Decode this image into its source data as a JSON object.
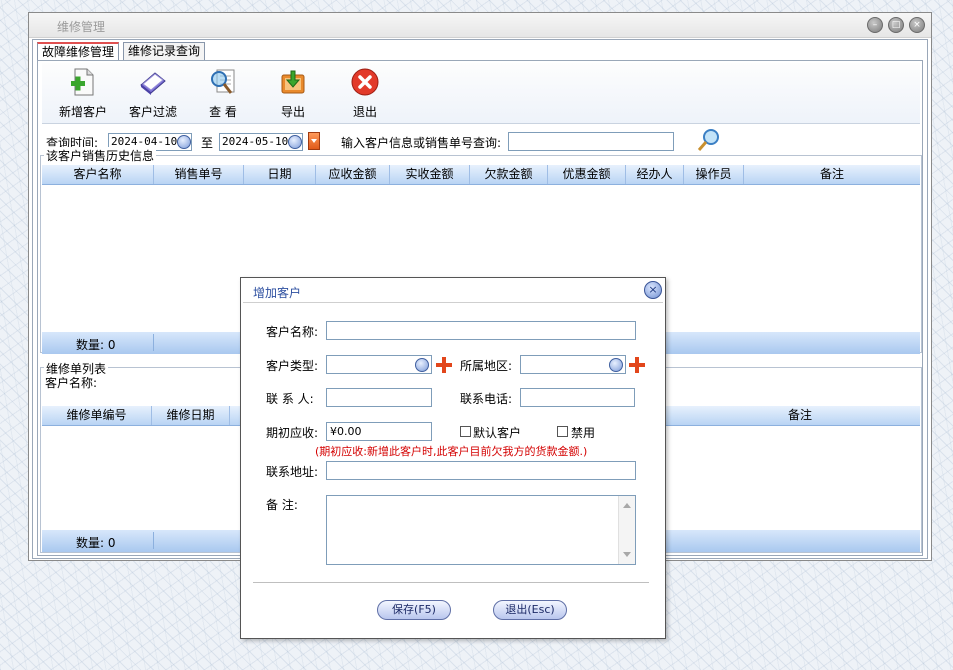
{
  "window": {
    "title": "维修管理"
  },
  "tabs": [
    {
      "label": "故障维修管理"
    },
    {
      "label": "维修记录查询"
    }
  ],
  "toolbar": {
    "buttons": [
      {
        "label": "新增客户",
        "icon": "add-document-icon"
      },
      {
        "label": "客户过滤",
        "icon": "filter-book-icon"
      },
      {
        "label": "查  看",
        "icon": "magnifier-icon"
      },
      {
        "label": "导出",
        "icon": "export-icon"
      },
      {
        "label": "退出",
        "icon": "exit-icon"
      }
    ]
  },
  "query": {
    "time_label": "查询时间:",
    "start_date": "2024-04-10",
    "to_label": "至",
    "end_date": "2024-05-10",
    "search_label": "输入客户信息或销售单号查询:",
    "search_value": ""
  },
  "sales_history": {
    "title": "该客户销售历史信息",
    "columns": [
      "客户名称",
      "销售单号",
      "日期",
      "应收金额",
      "实收金额",
      "欠款金额",
      "优惠金额",
      "经办人",
      "操作员",
      "备注"
    ],
    "count_label": "数量: 0"
  },
  "repair_list": {
    "title": "维修单列表",
    "customer_label": "客户名称:",
    "columns": [
      "维修单编号",
      "维修日期",
      "备注"
    ],
    "count_label": "数量: 0"
  },
  "dialog": {
    "title": "增加客户",
    "fields": {
      "name_label": "客户名称:",
      "type_label": "客户类型:",
      "region_label": "所属地区:",
      "contact_label": "联 系 人:",
      "phone_label": "联系电话:",
      "opening_label": "期初应收:",
      "opening_value": "¥0.00",
      "default_label": "默认客户",
      "disabled_label": "禁用",
      "hint": "(期初应收:新增此客户时,此客户目前欠我方的货款金额.)",
      "address_label": "联系地址:",
      "remark_label": "备    注:"
    },
    "buttons": {
      "save": "保存(F5)",
      "cancel": "退出(Esc)"
    }
  },
  "colors": {
    "accent": "#2d4fa0",
    "hint_red": "#d40000",
    "header_blue": "#b9d4f4"
  }
}
